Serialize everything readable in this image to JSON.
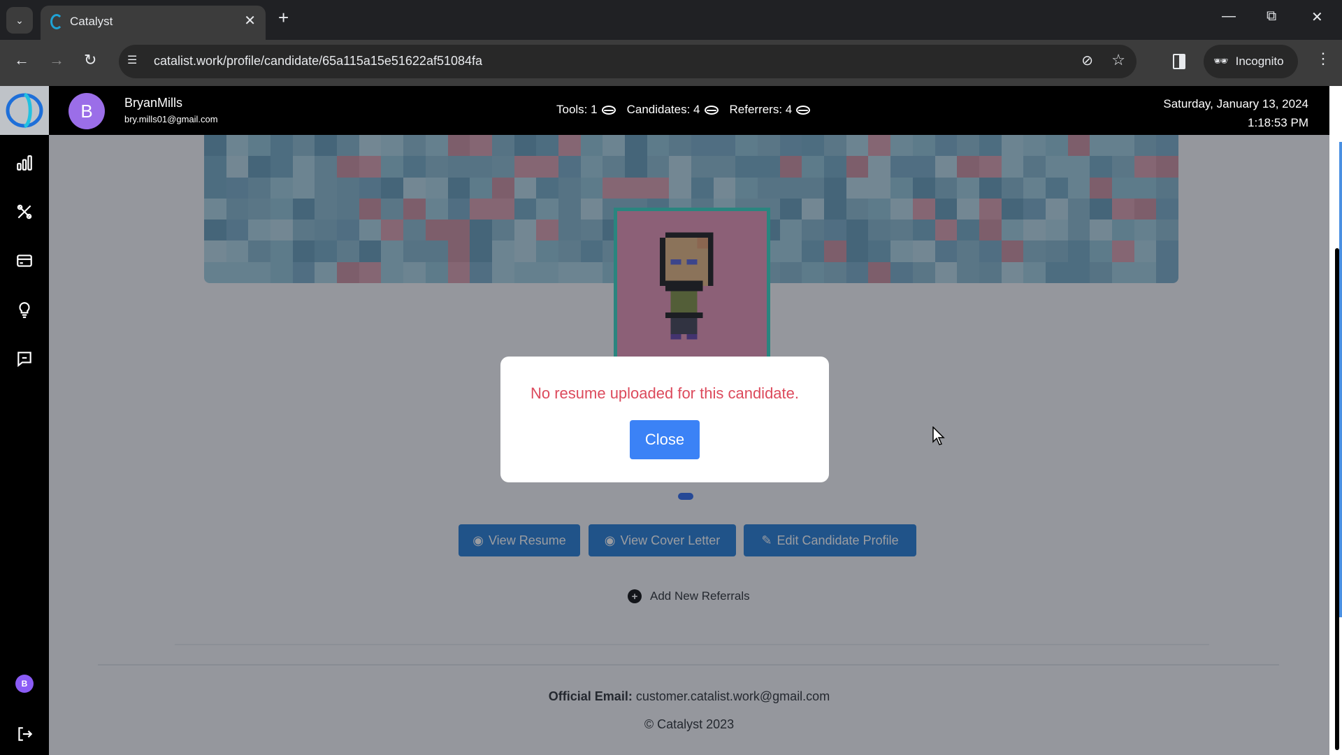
{
  "browser": {
    "tab_title": "Catalyst",
    "url": "catalist.work/profile/candidate/65a115a15e51622af51084fa",
    "incognito_label": "Incognito"
  },
  "header": {
    "avatar_initial": "B",
    "user_name": "BryanMills",
    "user_email": "bry.mills01@gmail.com",
    "counts": [
      {
        "label": "Tools: 1",
        "icon": "coin-icon"
      },
      {
        "label": "Candidates: 4",
        "icon": "coin-icon"
      },
      {
        "label": "Referrers: 4",
        "icon": "coin-icon"
      }
    ],
    "date": "Saturday, January 13, 2024",
    "time": "1:18:53 PM"
  },
  "sidebar": {
    "items": [
      {
        "name": "dashboard",
        "icon": "bar-chart-icon"
      },
      {
        "name": "tools",
        "icon": "tools-icon"
      },
      {
        "name": "billing",
        "icon": "credit-card-icon"
      },
      {
        "name": "ideas",
        "icon": "lightbulb-icon"
      },
      {
        "name": "messages",
        "icon": "chat-icon"
      }
    ],
    "avatar_initial": "B",
    "logout_icon": "logout-icon"
  },
  "profile": {
    "actions": [
      {
        "label": "View Resume",
        "icon": "eye-icon"
      },
      {
        "label": "View Cover Letter",
        "icon": "eye-icon"
      },
      {
        "label": "Edit Candidate Profile",
        "icon": "pencil-icon"
      }
    ],
    "add_referrals_label": "Add New Referrals"
  },
  "footer": {
    "email_label": "Official Email:",
    "email_value": "customer.catalist.work@gmail.com",
    "copyright": "© Catalyst 2023"
  },
  "modal": {
    "message": "No resume uploaded for this candidate.",
    "close_label": "Close"
  },
  "colors": {
    "primary_button": "#1976d2",
    "modal_button": "#3b82f6",
    "error_text": "#dc4a5c",
    "avatar": "#9b6ee8",
    "profile_border": "#2dd4bf"
  }
}
